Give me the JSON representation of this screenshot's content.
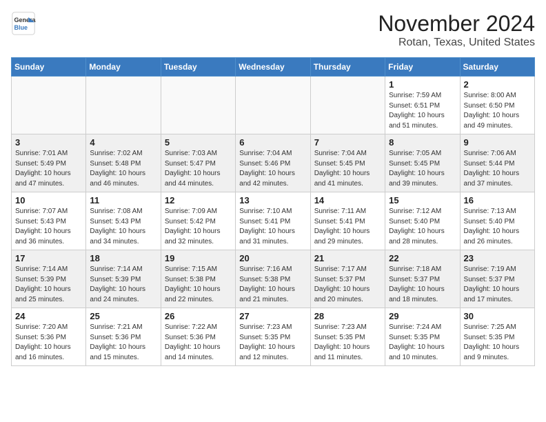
{
  "header": {
    "logo_line1": "General",
    "logo_line2": "Blue",
    "title": "November 2024",
    "subtitle": "Rotan, Texas, United States"
  },
  "weekdays": [
    "Sunday",
    "Monday",
    "Tuesday",
    "Wednesday",
    "Thursday",
    "Friday",
    "Saturday"
  ],
  "weeks": [
    [
      {
        "day": "",
        "info": "",
        "empty": true
      },
      {
        "day": "",
        "info": "",
        "empty": true
      },
      {
        "day": "",
        "info": "",
        "empty": true
      },
      {
        "day": "",
        "info": "",
        "empty": true
      },
      {
        "day": "",
        "info": "",
        "empty": true
      },
      {
        "day": "1",
        "info": "Sunrise: 7:59 AM\nSunset: 6:51 PM\nDaylight: 10 hours\nand 51 minutes.",
        "empty": false
      },
      {
        "day": "2",
        "info": "Sunrise: 8:00 AM\nSunset: 6:50 PM\nDaylight: 10 hours\nand 49 minutes.",
        "empty": false
      }
    ],
    [
      {
        "day": "3",
        "info": "Sunrise: 7:01 AM\nSunset: 5:49 PM\nDaylight: 10 hours\nand 47 minutes.",
        "empty": false
      },
      {
        "day": "4",
        "info": "Sunrise: 7:02 AM\nSunset: 5:48 PM\nDaylight: 10 hours\nand 46 minutes.",
        "empty": false
      },
      {
        "day": "5",
        "info": "Sunrise: 7:03 AM\nSunset: 5:47 PM\nDaylight: 10 hours\nand 44 minutes.",
        "empty": false
      },
      {
        "day": "6",
        "info": "Sunrise: 7:04 AM\nSunset: 5:46 PM\nDaylight: 10 hours\nand 42 minutes.",
        "empty": false
      },
      {
        "day": "7",
        "info": "Sunrise: 7:04 AM\nSunset: 5:45 PM\nDaylight: 10 hours\nand 41 minutes.",
        "empty": false
      },
      {
        "day": "8",
        "info": "Sunrise: 7:05 AM\nSunset: 5:45 PM\nDaylight: 10 hours\nand 39 minutes.",
        "empty": false
      },
      {
        "day": "9",
        "info": "Sunrise: 7:06 AM\nSunset: 5:44 PM\nDaylight: 10 hours\nand 37 minutes.",
        "empty": false
      }
    ],
    [
      {
        "day": "10",
        "info": "Sunrise: 7:07 AM\nSunset: 5:43 PM\nDaylight: 10 hours\nand 36 minutes.",
        "empty": false
      },
      {
        "day": "11",
        "info": "Sunrise: 7:08 AM\nSunset: 5:43 PM\nDaylight: 10 hours\nand 34 minutes.",
        "empty": false
      },
      {
        "day": "12",
        "info": "Sunrise: 7:09 AM\nSunset: 5:42 PM\nDaylight: 10 hours\nand 32 minutes.",
        "empty": false
      },
      {
        "day": "13",
        "info": "Sunrise: 7:10 AM\nSunset: 5:41 PM\nDaylight: 10 hours\nand 31 minutes.",
        "empty": false
      },
      {
        "day": "14",
        "info": "Sunrise: 7:11 AM\nSunset: 5:41 PM\nDaylight: 10 hours\nand 29 minutes.",
        "empty": false
      },
      {
        "day": "15",
        "info": "Sunrise: 7:12 AM\nSunset: 5:40 PM\nDaylight: 10 hours\nand 28 minutes.",
        "empty": false
      },
      {
        "day": "16",
        "info": "Sunrise: 7:13 AM\nSunset: 5:40 PM\nDaylight: 10 hours\nand 26 minutes.",
        "empty": false
      }
    ],
    [
      {
        "day": "17",
        "info": "Sunrise: 7:14 AM\nSunset: 5:39 PM\nDaylight: 10 hours\nand 25 minutes.",
        "empty": false
      },
      {
        "day": "18",
        "info": "Sunrise: 7:14 AM\nSunset: 5:39 PM\nDaylight: 10 hours\nand 24 minutes.",
        "empty": false
      },
      {
        "day": "19",
        "info": "Sunrise: 7:15 AM\nSunset: 5:38 PM\nDaylight: 10 hours\nand 22 minutes.",
        "empty": false
      },
      {
        "day": "20",
        "info": "Sunrise: 7:16 AM\nSunset: 5:38 PM\nDaylight: 10 hours\nand 21 minutes.",
        "empty": false
      },
      {
        "day": "21",
        "info": "Sunrise: 7:17 AM\nSunset: 5:37 PM\nDaylight: 10 hours\nand 20 minutes.",
        "empty": false
      },
      {
        "day": "22",
        "info": "Sunrise: 7:18 AM\nSunset: 5:37 PM\nDaylight: 10 hours\nand 18 minutes.",
        "empty": false
      },
      {
        "day": "23",
        "info": "Sunrise: 7:19 AM\nSunset: 5:37 PM\nDaylight: 10 hours\nand 17 minutes.",
        "empty": false
      }
    ],
    [
      {
        "day": "24",
        "info": "Sunrise: 7:20 AM\nSunset: 5:36 PM\nDaylight: 10 hours\nand 16 minutes.",
        "empty": false
      },
      {
        "day": "25",
        "info": "Sunrise: 7:21 AM\nSunset: 5:36 PM\nDaylight: 10 hours\nand 15 minutes.",
        "empty": false
      },
      {
        "day": "26",
        "info": "Sunrise: 7:22 AM\nSunset: 5:36 PM\nDaylight: 10 hours\nand 14 minutes.",
        "empty": false
      },
      {
        "day": "27",
        "info": "Sunrise: 7:23 AM\nSunset: 5:35 PM\nDaylight: 10 hours\nand 12 minutes.",
        "empty": false
      },
      {
        "day": "28",
        "info": "Sunrise: 7:23 AM\nSunset: 5:35 PM\nDaylight: 10 hours\nand 11 minutes.",
        "empty": false
      },
      {
        "day": "29",
        "info": "Sunrise: 7:24 AM\nSunset: 5:35 PM\nDaylight: 10 hours\nand 10 minutes.",
        "empty": false
      },
      {
        "day": "30",
        "info": "Sunrise: 7:25 AM\nSunset: 5:35 PM\nDaylight: 10 hours\nand 9 minutes.",
        "empty": false
      }
    ]
  ]
}
